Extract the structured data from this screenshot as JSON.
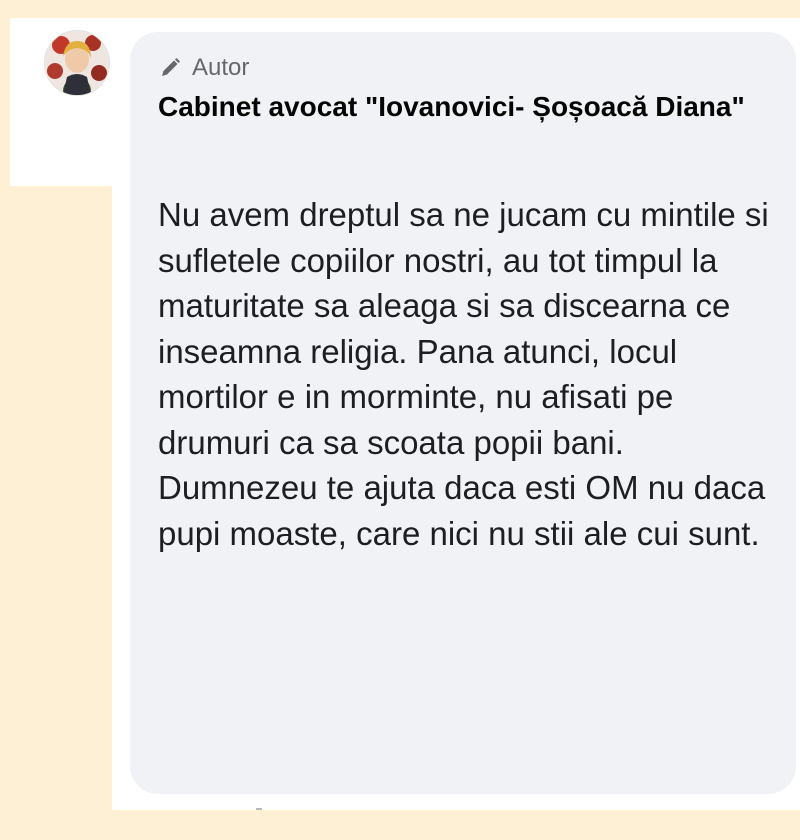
{
  "comment": {
    "badge": {
      "icon": "pencil-icon",
      "label": "Autor"
    },
    "author": "Cabinet avocat \"Iovanovici- Șoșoacă Diana\"",
    "text": "Nu avem dreptul sa ne jucam cu mintile si sufletele copiilor nostri, au tot timpul la maturitate sa aleaga si sa discearna ce inseamna religia. Pana atunci, locul mortilor e in morminte, nu afisati pe drumuri ca sa scoata popii bani. Dumnezeu te ajuta daca esti OM nu daca pupi moaste, care nici nu stii ale cui sunt."
  },
  "colors": {
    "page_background": "#fdf0d5",
    "bubble_background": "#f0f2f5",
    "text": "#1c1e21",
    "secondary_text": "#65676b"
  }
}
